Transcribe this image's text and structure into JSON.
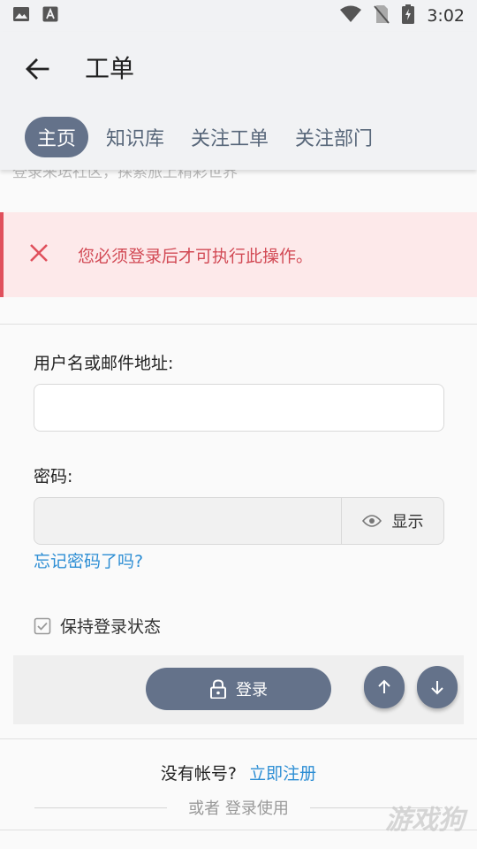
{
  "status_bar": {
    "time": "3:02"
  },
  "app_bar": {
    "title": "工单",
    "tabs": [
      {
        "label": "主页",
        "active": true
      },
      {
        "label": "知识库",
        "active": false
      },
      {
        "label": "关注工单",
        "active": false
      },
      {
        "label": "关注部门",
        "active": false
      }
    ]
  },
  "content": {
    "cut_off_text": "登录来坛社区，探索旅上精彩世界",
    "alert": {
      "message": "您必须登录后才可执行此操作。"
    },
    "username_label": "用户名或邮件地址:",
    "username_value": "",
    "password_label": "密码:",
    "password_value": "",
    "show_password_label": "显示",
    "forgot_password": "忘记密码了吗?",
    "remember_me_label": "保持登录状态",
    "login_button": "登录",
    "no_account_text": "没有帐号?",
    "signup_link": "立即注册",
    "or_login_text": "或者 登录使用"
  },
  "watermark": "游戏狗",
  "colors": {
    "primary": "#64728a",
    "link": "#2d8ed4",
    "error": "#d24a55",
    "error_bg": "#fde9ea"
  }
}
